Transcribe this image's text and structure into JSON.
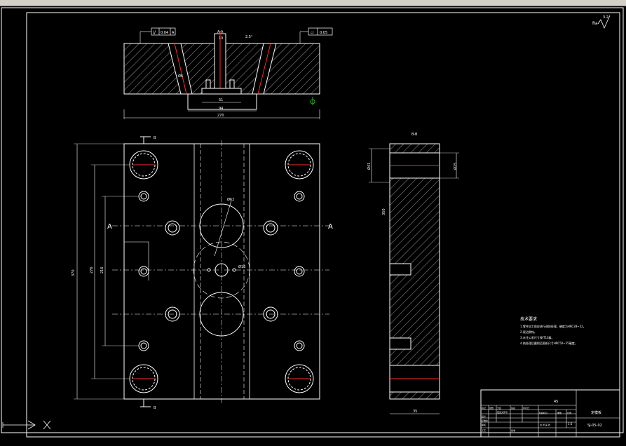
{
  "toolbar": {
    "items": [
      "open-icon",
      "save-icon",
      "print-icon",
      "cut-icon",
      "copy-icon",
      "paste-icon",
      "undo-icon",
      "redo-icon",
      "pan-icon",
      "zoom-icon",
      "properties-icon",
      "layer-icon",
      "match-icon",
      "help-icon"
    ],
    "colors": {
      "bg": "#d4d0c8",
      "accent": "#1f4fbf",
      "yellow": "#e7c400"
    }
  },
  "drawing": {
    "colors": {
      "line": "#ffffff",
      "center": "#ff2a2a",
      "dim": "#ffffff",
      "green": "#2fd02f"
    },
    "roughness": {
      "symbol": "Ra",
      "value": "3.2"
    },
    "top_view": {
      "section_label": "A-A",
      "tolerance_left": {
        "symbol": "//",
        "value": "0.04",
        "datum": "A"
      },
      "tolerance_right": {
        "symbol": "▱",
        "value": "0.05"
      },
      "angle_note": "2.5°",
      "hole_dim": "Ø6",
      "dim_top_small": "10",
      "dim_slot": "51",
      "dim_inner": "94",
      "dim_total": "270"
    },
    "plan_view": {
      "cut_b_top": "B",
      "cut_b_bottom": "B",
      "cut_a_left": "A",
      "cut_a_right": "A",
      "dim_overall": "370",
      "dim_mid1": "276",
      "dim_mid2": "216",
      "dim_circle": "Ø62",
      "dim_small": "Ø10"
    },
    "side_view": {
      "section_label": "B-B",
      "dim_left": "Ø41",
      "dim_right": "Ø25",
      "dim_mid": "350",
      "dim_bottom": "35"
    },
    "notes": {
      "title": "技术要求",
      "lines": [
        "1.零件加工前应进行调质处理，硬度为HRC28~32。",
        "2.锐边倒钝。",
        "3.未注公差尺寸按IT13级。",
        "4.热处理后磨削至图纸尺寸HRC50~55硬度。"
      ]
    },
    "title_block": {
      "scale_val": "1:5",
      "part_name": "定模板",
      "drawing_no": "SJ-05-02",
      "material": "45",
      "cells": [
        "标记",
        "处数",
        "分区",
        "更改文件号",
        "签名",
        "年月日",
        "设计",
        "审核",
        "工艺",
        "批准",
        "标准化",
        "阶段标记",
        "重量",
        "比例",
        "共 张 第 张"
      ]
    },
    "command": {
      "coordinate_icon": "ucs-icon",
      "cross_icon": "cursor-cross-icon"
    }
  }
}
